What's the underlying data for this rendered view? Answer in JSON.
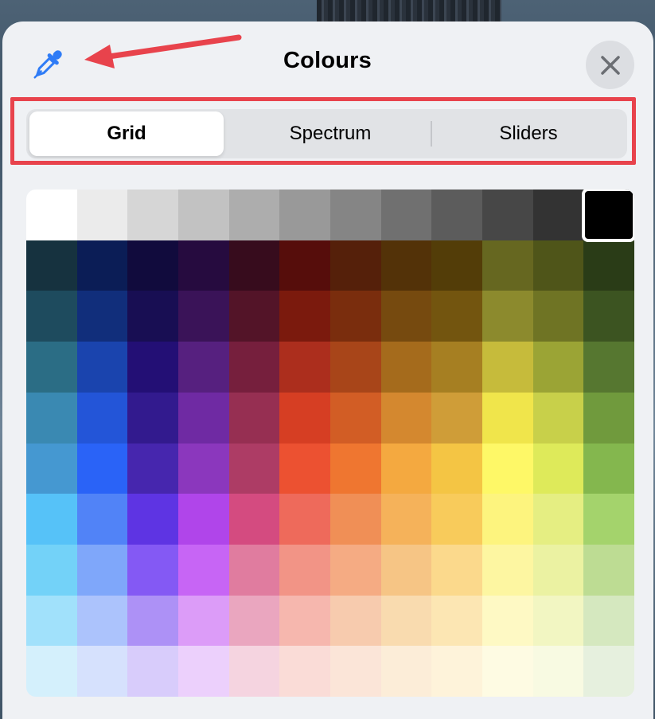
{
  "dialog": {
    "title": "Colours",
    "close_icon": "close-icon",
    "eyedropper_icon": "eyedropper-icon"
  },
  "tabs": [
    {
      "label": "Grid",
      "selected": true
    },
    {
      "label": "Spectrum",
      "selected": false
    },
    {
      "label": "Sliders",
      "selected": false
    }
  ],
  "colors": {
    "accent": "#2f7cf6",
    "annotation": "#e8434c",
    "panel_bg": "#eff1f4"
  },
  "grid": {
    "columns": 12,
    "rows": 10,
    "selected_index": 11,
    "swatches": [
      "#ffffff",
      "#ebebeb",
      "#d6d6d6",
      "#c2c2c2",
      "#adadad",
      "#999999",
      "#858585",
      "#707070",
      "#5c5c5c",
      "#474747",
      "#333333",
      "#000000",
      "#16323f",
      "#0b1d56",
      "#110b3d",
      "#260b3f",
      "#370c1d",
      "#560d0b",
      "#55200a",
      "#533208",
      "#533d08",
      "#666720",
      "#4f5519",
      "#2a3c17",
      "#1e4b5e",
      "#112e7b",
      "#180e53",
      "#3a1358",
      "#531428",
      "#7b1a0d",
      "#7a2d0d",
      "#764a0f",
      "#73550f",
      "#8c8a2d",
      "#6f7424",
      "#3c5421",
      "#2b6d85",
      "#1a44ae",
      "#230f75",
      "#56207f",
      "#761f3d",
      "#ac2e1d",
      "#a84519",
      "#a56b1c",
      "#a67f22",
      "#c6bb3b",
      "#9ba435",
      "#567730",
      "#3a89b2",
      "#2355d8",
      "#321a8e",
      "#6f2aa3",
      "#962f52",
      "#d63e23",
      "#d25d25",
      "#d4882f",
      "#cf9d38",
      "#f0e54b",
      "#c8d04a",
      "#709a3d",
      "#4598d1",
      "#2a63f7",
      "#4626ae",
      "#8b37bd",
      "#ad3c65",
      "#ec5131",
      "#ef7630",
      "#f4a940",
      "#f4c544",
      "#fef867",
      "#deea5a",
      "#84b74e",
      "#56c2f8",
      "#5183f7",
      "#5e34e3",
      "#b045ea",
      "#d44b80",
      "#ee6a5b",
      "#f08f56",
      "#f5b25a",
      "#f8cb5b",
      "#fdf47e",
      "#e5ee82",
      "#a4d36c",
      "#73d2f8",
      "#7fa7fa",
      "#8459f4",
      "#c765f5",
      "#e07c9f",
      "#f29486",
      "#f5ab83",
      "#f6c585",
      "#fbd98c",
      "#fdf6a1",
      "#ebf2a2",
      "#bddc93",
      "#a1e1fb",
      "#acc3fc",
      "#ad91f6",
      "#dc9cf8",
      "#eaa6bf",
      "#f6b7ae",
      "#f7cbae",
      "#f9dbaf",
      "#fce6b3",
      "#fef9c4",
      "#f2f6c2",
      "#d5e8bf",
      "#d4f0fc",
      "#d6e1fd",
      "#d8ccfb",
      "#ecd0fc",
      "#f5d4e0",
      "#fadcd7",
      "#fbe5d8",
      "#fcedd8",
      "#fef3da",
      "#fefbe3",
      "#f8fae2",
      "#e6f0de"
    ]
  }
}
